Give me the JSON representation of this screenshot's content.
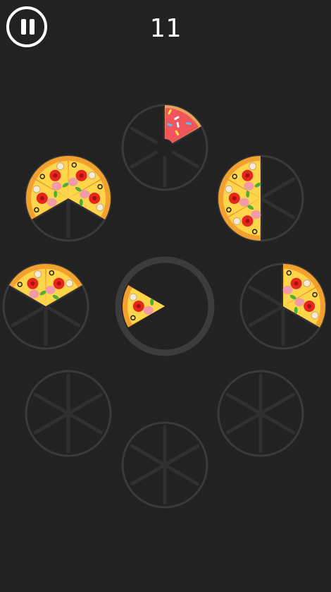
{
  "game": {
    "score": "11",
    "pause_icon": "pause-icon",
    "colors": {
      "background": "#222222",
      "plate_ring": "#3a3a3a",
      "plate_spoke": "#303030",
      "center_ring": "#3c3c3c",
      "pizza_crust": "#f2a12e",
      "pizza_cheese": "#ffd54a",
      "donut_dough": "#e8a35a",
      "donut_icing": "#f2545b"
    },
    "center_slice": {
      "type": "pizza",
      "slices": 1
    },
    "plates": [
      {
        "name": "plate-top",
        "fill": [
          {
            "type": "donut",
            "slices": 1
          }
        ]
      },
      {
        "name": "plate-upper-left",
        "fill": [
          {
            "type": "pizza",
            "slices": 4
          }
        ]
      },
      {
        "name": "plate-upper-right",
        "fill": [
          {
            "type": "pizza",
            "slices": 3
          }
        ]
      },
      {
        "name": "plate-middle-left",
        "fill": [
          {
            "type": "pizza",
            "slices": 2
          }
        ]
      },
      {
        "name": "plate-middle-right",
        "fill": [
          {
            "type": "pizza",
            "slices": 2
          }
        ]
      },
      {
        "name": "plate-lower-left",
        "fill": []
      },
      {
        "name": "plate-lower-right",
        "fill": []
      },
      {
        "name": "plate-bottom",
        "fill": []
      }
    ]
  }
}
